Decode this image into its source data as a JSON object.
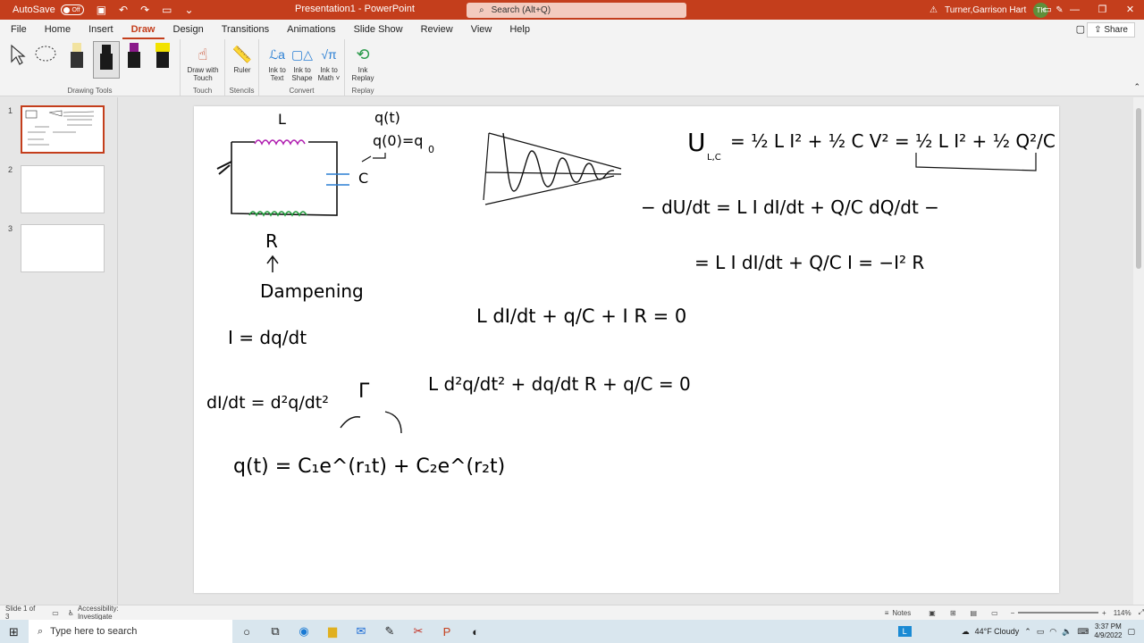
{
  "window": {
    "autosave_label": "AutoSave",
    "autosave_state": "Off",
    "doc_title": "Presentation1 - PowerPoint",
    "search_placeholder": "Search (Alt+Q)",
    "user_name": "Turner,Garrison Hart",
    "user_initials": "TH"
  },
  "tabs": [
    "File",
    "Home",
    "Insert",
    "Draw",
    "Design",
    "Transitions",
    "Animations",
    "Slide Show",
    "Review",
    "View",
    "Help"
  ],
  "active_tab": "Draw",
  "share_label": "Share",
  "ribbon": {
    "groups": {
      "drawing_tools": "Drawing Tools",
      "touch": "Touch",
      "stencils": "Stencils",
      "convert": "Convert",
      "replay": "Replay"
    },
    "draw_with_touch_1": "Draw with",
    "draw_with_touch_2": "Touch",
    "ruler": "Ruler",
    "ink_to_text_1": "Ink to",
    "ink_to_text_2": "Text",
    "ink_to_shape_1": "Ink to",
    "ink_to_shape_2": "Shape",
    "ink_to_math_1": "Ink to",
    "ink_to_math_2": "Math ˅",
    "ink_replay_1": "Ink",
    "ink_replay_2": "Replay",
    "pen_colors": [
      "#1a1a1a",
      "#1a1a1a",
      "#8b1a8b",
      "#f2e200"
    ]
  },
  "slides": [
    "1",
    "2",
    "3"
  ],
  "slide_ink": {
    "L_top": "L",
    "q_t": "q(t)",
    "q_0": "q(0)=q",
    "q_0_sub": "0",
    "C_label": "C",
    "R_label": "R",
    "dampening": "Dampening",
    "energy_U": "U",
    "energy_sub": "L,C",
    "energy_eq": "= ½ L I² + ½ C V² = ½ L I² + ½ Q²/C",
    "dUdt_line": "− dU/dt = L I dI/dt + Q/C dQ/dt −",
    "dUdt_line2": "= L I dI/dt + Q/C I = −I² R",
    "ode1": "L dI/dt + q/C + I R = 0",
    "I_def": "I = dq/dt",
    "dI_def": "dI/dt = d²q/dt²",
    "ode2": "L d²q/dt² + dq/dt R + q/C = 0",
    "gamma": "Γ",
    "solution": "q(t) = C₁e^(r₁t) + C₂e^(r₂t)"
  },
  "status": {
    "slide_info": "Slide 1 of 3",
    "accessibility": "Accessibility: Investigate",
    "notes": "Notes",
    "zoom": "114%"
  },
  "taskbar": {
    "search_placeholder": "Type here to search",
    "weather": "44°F Cloudy",
    "time": "3:37 PM",
    "date": "4/9/2022"
  },
  "colors": {
    "accent": "#c43e1c",
    "inductor": "#b01eb0",
    "resistor": "#1f9a3a",
    "capacitor": "#2a7fd4"
  }
}
